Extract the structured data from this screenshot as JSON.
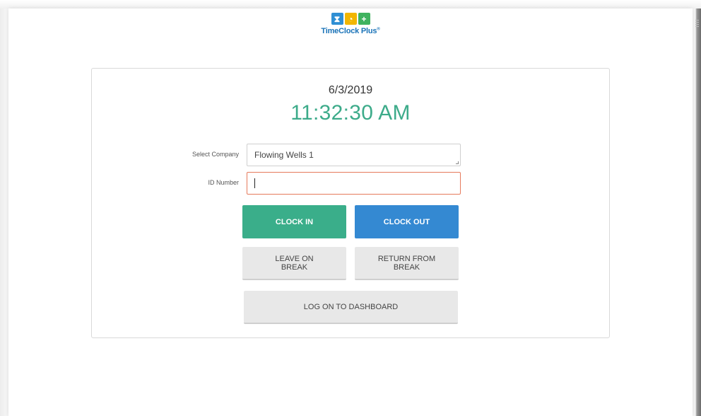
{
  "logo": {
    "brand": "TimeClock Plus",
    "mark": "®"
  },
  "clock": {
    "date": "6/3/2019",
    "time": "11:32:30 AM"
  },
  "form": {
    "company_label": "Select Company",
    "company_value": "Flowing Wells  1",
    "id_label": "ID Number",
    "id_value": ""
  },
  "buttons": {
    "clock_in": "CLOCK IN",
    "clock_out": "CLOCK OUT",
    "leave_break_line1": "LEAVE ON",
    "leave_break_line2": "BREAK",
    "return_break_line1": "RETURN FROM",
    "return_break_line2": "BREAK",
    "dashboard": "LOG ON TO DASHBOARD"
  },
  "colors": {
    "clock_in": "#3aae8a",
    "clock_out": "#3489d2",
    "time_text": "#3dab8a",
    "focus_border": "#e67a5c"
  }
}
